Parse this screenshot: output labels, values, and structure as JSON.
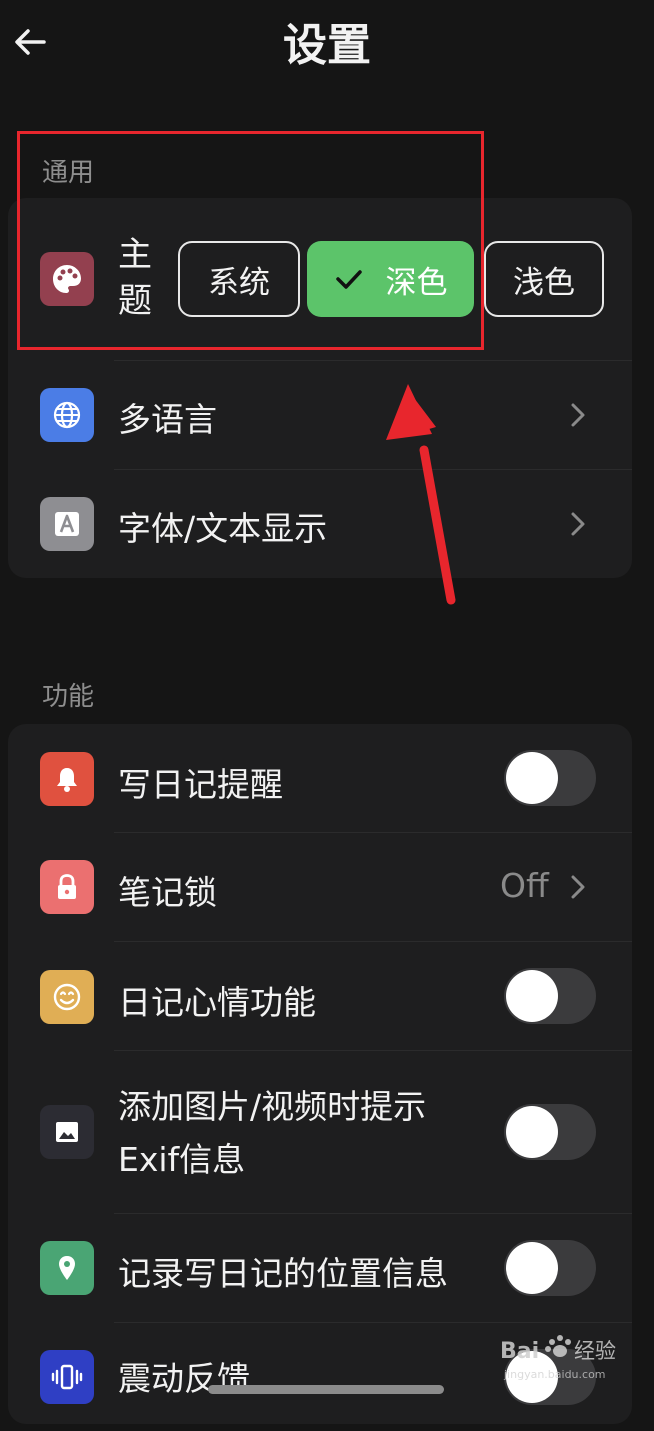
{
  "header": {
    "title": "设置"
  },
  "general": {
    "section_label": "通用",
    "theme": {
      "label": "主\n题",
      "options": [
        "系统",
        "深色",
        "浅色"
      ],
      "selected": "深色"
    },
    "items": [
      {
        "label": "多语言"
      },
      {
        "label": "字体/文本显示"
      }
    ]
  },
  "features": {
    "section_label": "功能",
    "items": [
      {
        "label": "写日记提醒",
        "toggle": false
      },
      {
        "label": "笔记锁",
        "value": "Off"
      },
      {
        "label": "日记心情功能",
        "toggle": false
      },
      {
        "label": "添加图片/视频时提示\nExif信息",
        "toggle": false
      },
      {
        "label": "记录写日记的位置信息",
        "toggle": false
      },
      {
        "label": "震动反馈",
        "toggle": false
      }
    ]
  },
  "colors": {
    "background": "#151515",
    "card": "#1e1e1f",
    "accent_green": "#5cc46a",
    "annotation_red": "#e8262d"
  },
  "watermark": {
    "text": "Baidu经验",
    "subtext": "jingyan.baidu.com"
  }
}
